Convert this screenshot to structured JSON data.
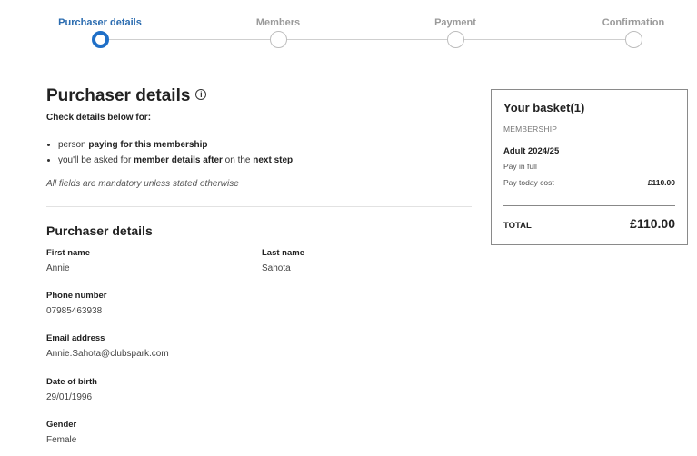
{
  "stepper": {
    "steps": [
      {
        "label": "Purchaser details",
        "active": true
      },
      {
        "label": "Members",
        "active": false
      },
      {
        "label": "Payment",
        "active": false
      },
      {
        "label": "Confirmation",
        "active": false
      }
    ]
  },
  "main": {
    "title": "Purchaser details",
    "check_heading": "Check details below for:",
    "bullet1": {
      "pre": "person ",
      "bold": "paying for this membership"
    },
    "bullet2": {
      "pre": "you'll be asked for ",
      "bold1": "member details after",
      "mid": " on the ",
      "bold2": "next step"
    },
    "mandatory_note": "All fields are mandatory unless stated otherwise",
    "section_title": "Purchaser details",
    "fields": {
      "first_name": {
        "label": "First name",
        "value": "Annie"
      },
      "last_name": {
        "label": "Last name",
        "value": "Sahota"
      },
      "phone": {
        "label": "Phone number",
        "value": "07985463938"
      },
      "email": {
        "label": "Email address",
        "value": "Annie.Sahota@clubspark.com"
      },
      "dob": {
        "label": "Date of birth",
        "value": "29/01/1996"
      },
      "gender": {
        "label": "Gender",
        "value": "Female"
      }
    }
  },
  "basket": {
    "title": "Your basket(1)",
    "category": "MEMBERSHIP",
    "item_name": "Adult 2024/25",
    "plan": "Pay in full",
    "pay_today_label": "Pay today cost",
    "pay_today_amount": "£110.00",
    "total_label": "TOTAL",
    "total_amount": "£110.00"
  },
  "colors": {
    "accent": "#1f6fc7",
    "active_label": "#2b6cb0",
    "inactive": "#9a9a9a"
  }
}
